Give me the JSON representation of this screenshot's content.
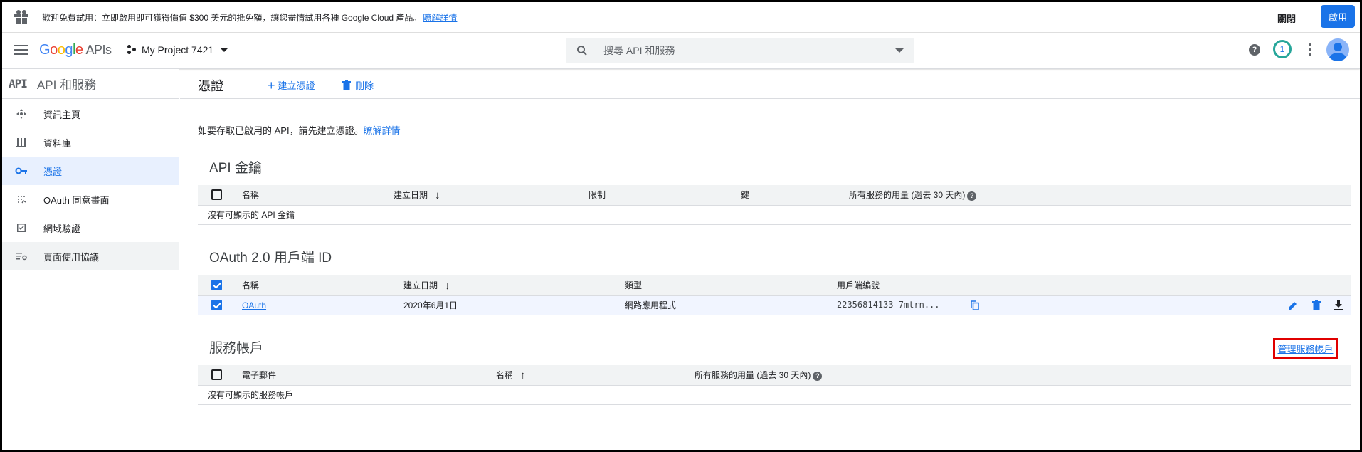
{
  "promo": {
    "message": "歡迎免費試用：立即啟用即可獲得價值 $300 美元的抵免額，讓您盡情試用各種 Google Cloud 產品。",
    "learn_more": "瞭解詳情",
    "dismiss": "關閉",
    "enable": "啟用"
  },
  "appbar": {
    "logo_google": [
      "G",
      "o",
      "o",
      "g",
      "l",
      "e"
    ],
    "logo_apis": "APIs",
    "project": "My Project 7421",
    "search_placeholder": "搜尋 API 和服務",
    "notification_count": "1",
    "help_glyph": "?"
  },
  "sidebar": {
    "logo": "API",
    "title": "API 和服務",
    "items": [
      {
        "label": "資訊主頁",
        "icon": "dashboard-icon"
      },
      {
        "label": "資料庫",
        "icon": "library-icon"
      },
      {
        "label": "憑證",
        "icon": "key-icon",
        "active": true
      },
      {
        "label": "OAuth 同意畫面",
        "icon": "consent-icon"
      },
      {
        "label": "網域驗證",
        "icon": "checkbox-icon"
      },
      {
        "label": "頁面使用協議",
        "icon": "settings-list-icon"
      }
    ]
  },
  "toolbar": {
    "title": "憑證",
    "create": "建立憑證",
    "delete": "刪除"
  },
  "intro": {
    "text": "如要存取已啟用的 API，請先建立憑證。",
    "link": "瞭解詳情"
  },
  "api_keys": {
    "title": "API 金鑰",
    "headers": [
      "名稱",
      "建立日期",
      "限制",
      "鍵",
      "所有服務的用量 (過去 30 天內)"
    ],
    "empty": "沒有可顯示的 API 金鑰"
  },
  "oauth": {
    "title": "OAuth 2.0 用戶端 ID",
    "headers": [
      "名稱",
      "建立日期",
      "類型",
      "用戶端編號"
    ],
    "rows": [
      {
        "name": "OAuth",
        "date": "2020年6月1日",
        "type": "網路應用程式",
        "client_id": "22356814133-7mtrn..."
      }
    ]
  },
  "service_accounts": {
    "title": "服務帳戶",
    "manage": "管理服務帳戶",
    "headers": [
      "電子郵件",
      "名稱",
      "所有服務的用量 (過去 30 天內)"
    ],
    "empty": "沒有可顯示的服務帳戶"
  },
  "colors": {
    "accent": "#1a73e8",
    "highlight_box": "#e00000",
    "active_bg": "#e8f0fe"
  }
}
